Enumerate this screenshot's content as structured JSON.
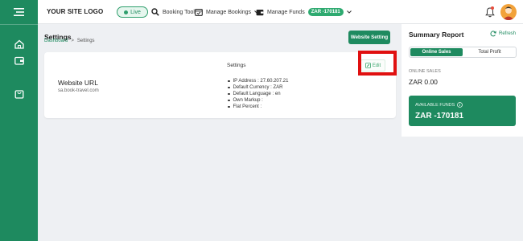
{
  "header": {
    "logo": "YOUR SITE LOGO",
    "live_label": "Live",
    "nav": [
      {
        "label": "Booking Tool",
        "icon": "search-icon"
      },
      {
        "label": "Manage Bookings",
        "icon": "calendar-icon"
      },
      {
        "label": "Manage Funds",
        "icon": "wallet-icon",
        "badge": "ZAR -170181"
      }
    ]
  },
  "sidebar": {
    "items": [
      {
        "icon": "menu-icon"
      },
      {
        "icon": "home-icon"
      },
      {
        "icon": "wallet-icon"
      },
      {
        "icon": "shopping-bag-icon"
      }
    ]
  },
  "page": {
    "title": "Settings",
    "breadcrumb": [
      "Dashboard",
      ">",
      "Settings"
    ],
    "website_setting_button": "Website Setting"
  },
  "settings_card": {
    "heading": "Settings",
    "url_title": "Website URL",
    "url_value": "sa.book-travel.com",
    "edit_label": "Edit",
    "items": [
      "IP Address : 27.60.207.21",
      "Default Currency : ZAR",
      "Default Language : en",
      "Own Markup :",
      "Flat Percent :"
    ]
  },
  "summary": {
    "title": "Summary Report",
    "refresh_label": "Refresh",
    "tabs": [
      "Online Sales",
      "Total Profit"
    ],
    "online_sales_label": "ONLINE SALES",
    "online_sales_value": "ZAR 0.00",
    "available_funds_label": "AVAILABLE FUNDS",
    "available_funds_value": "ZAR -170181"
  },
  "colors": {
    "brand": "#1e8a5f",
    "highlight": "#e01010"
  }
}
